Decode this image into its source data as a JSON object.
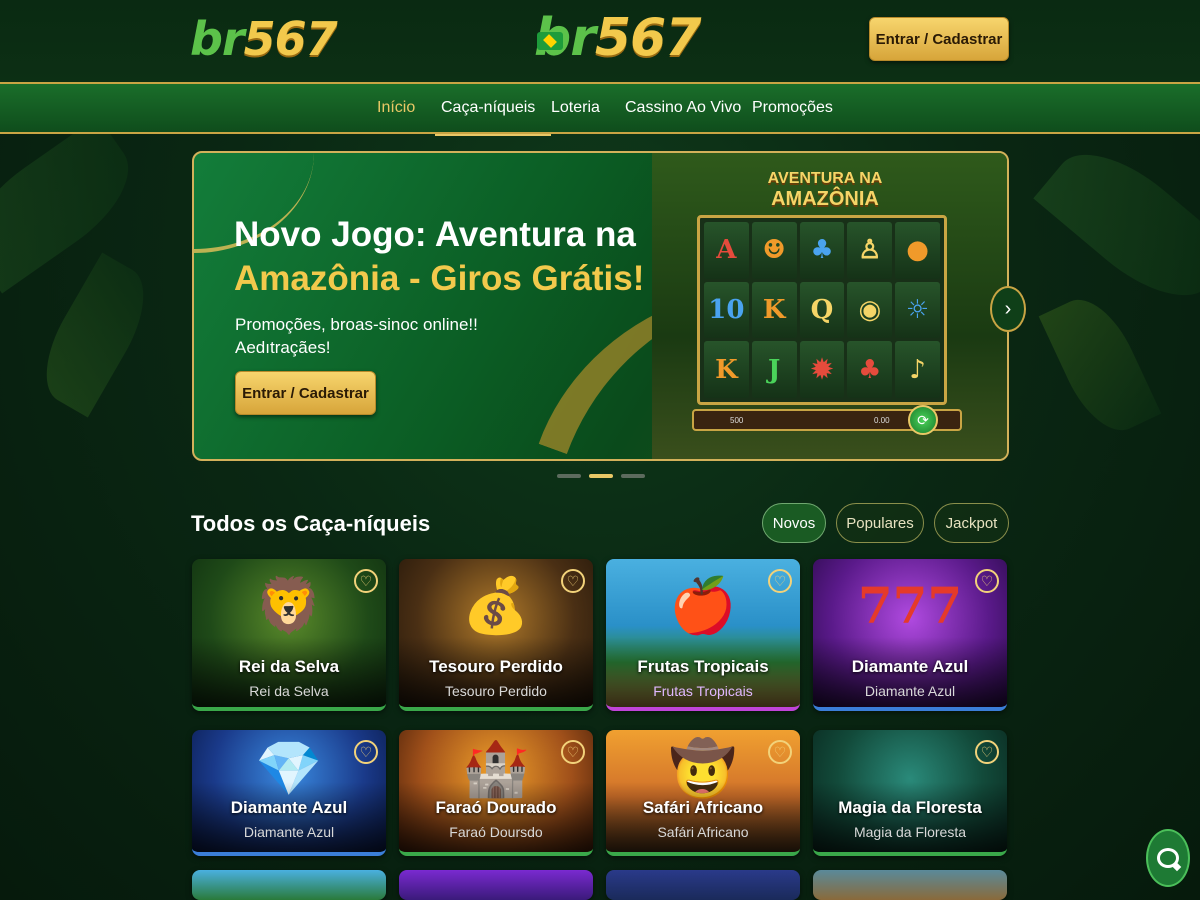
{
  "header": {
    "logo_left": {
      "br": "br",
      "num": "567"
    },
    "logo_center": {
      "br": "br",
      "num": "567"
    },
    "cta": "Entrar / Cadastrar"
  },
  "nav": {
    "items": [
      {
        "label": "Início",
        "active": true
      },
      {
        "label": "Caça-níqueis",
        "active": false
      },
      {
        "label": "Loteria",
        "active": false
      },
      {
        "label": "Cassino Ao Vivo",
        "active": false
      },
      {
        "label": "Promoções",
        "active": false
      }
    ]
  },
  "banner": {
    "title_line1": "Novo Jogo: Aventura na",
    "title_line2": "Amazônia - Giros Grátis!",
    "subtitle_line1": "Promoções, broas-sinoc online!!",
    "subtitle_line2": "Aedıtraçães!",
    "cta": "Entrar / Cadastrar",
    "slot": {
      "title_small": "AVENTURA NA",
      "title_big": "AMAZÔNIA",
      "reels": [
        [
          "A",
          "☻",
          "♣",
          "♙",
          "●"
        ],
        [
          "10",
          "K",
          "Q",
          "◉",
          "☼"
        ],
        [
          "K",
          "J",
          "✹",
          "♣",
          "♪"
        ]
      ],
      "bar_left": "500",
      "bar_right": "0.00"
    },
    "slides_total": 3,
    "slide_active": 2
  },
  "section": {
    "title": "Todos os Caça-níqueis",
    "filters": [
      {
        "label": "Novos",
        "active": true
      },
      {
        "label": "Populares",
        "active": false
      },
      {
        "label": "Jackpot",
        "active": false
      }
    ]
  },
  "games": [
    {
      "title": "Rei da Selva",
      "subtitle": "Rei da Selva",
      "motif": "🦁",
      "theme": "jungle",
      "bar": "green"
    },
    {
      "title": "Tesouro Perdido",
      "subtitle": "Tesouro Perdido",
      "motif": "💰",
      "theme": "treasure",
      "bar": "green"
    },
    {
      "title": "Frutas Tropicais",
      "subtitle": "Frutas Tropicais",
      "motif": "🍎",
      "theme": "fruits",
      "bar": "purple"
    },
    {
      "title": "Diamante Azul",
      "subtitle": "Diamante Azul",
      "motif": "777",
      "theme": "casino",
      "bar": "blue"
    },
    {
      "title": "Diamante Azul",
      "subtitle": "Diamante Azul",
      "motif": "💎",
      "theme": "diamond",
      "bar": "blue"
    },
    {
      "title": "Faraó Dourado",
      "subtitle": "Faraó Doursdo",
      "motif": "🏰",
      "theme": "pharaoh",
      "bar": "green"
    },
    {
      "title": "Safári Africano",
      "subtitle": "Safári Africano",
      "motif": "🤠",
      "theme": "safari",
      "bar": "green"
    },
    {
      "title": "Magia da Floresta",
      "subtitle": "Magia da Floresta",
      "motif": "",
      "theme": "forest",
      "bar": "green"
    }
  ],
  "colors": {
    "brand_green": "#1a6e2a",
    "gold": "#f2c94c",
    "background": "#0a2713"
  }
}
